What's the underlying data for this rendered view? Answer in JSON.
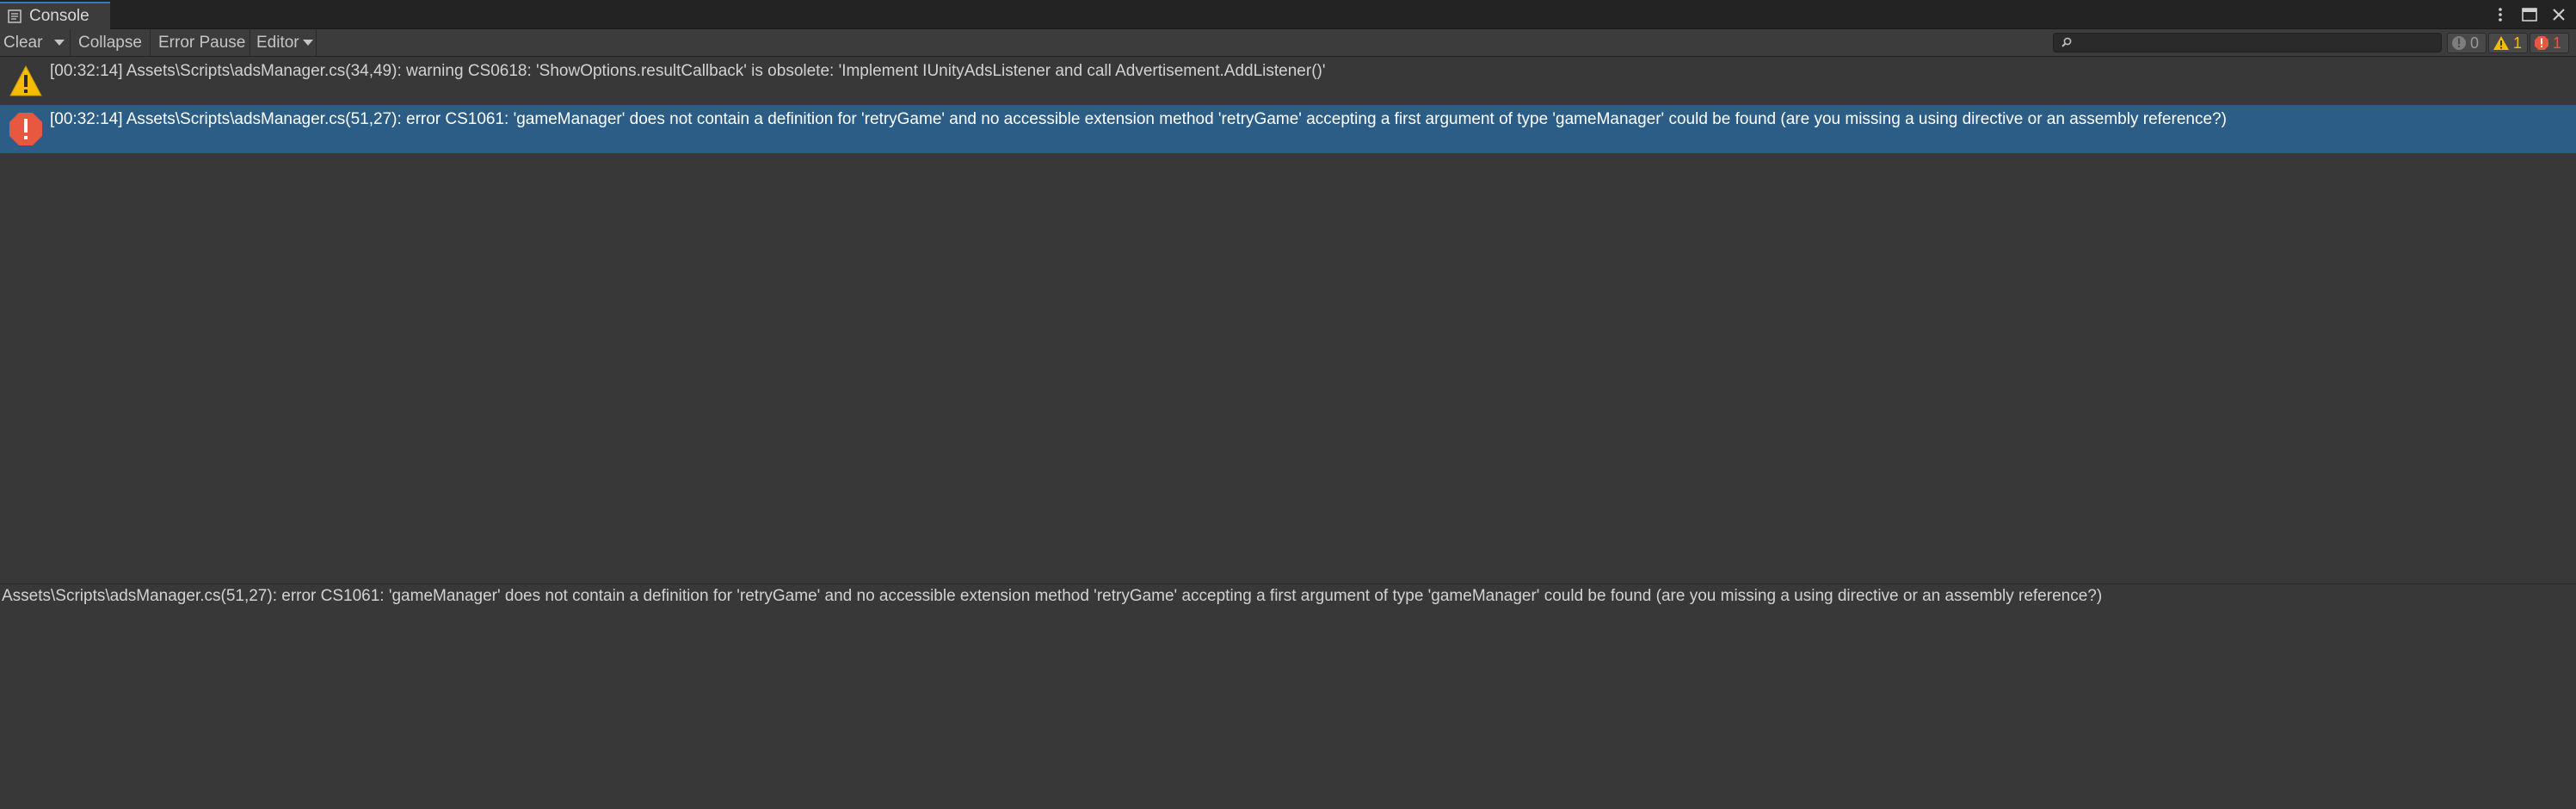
{
  "window": {
    "tab_title": "Console",
    "icons": [
      "console-icon",
      "kebab-menu-icon",
      "maximize-icon",
      "close-icon"
    ]
  },
  "toolbar": {
    "clear_label": "Clear",
    "collapse_label": "Collapse",
    "error_pause_label": "Error Pause",
    "editor_label": "Editor",
    "search": {
      "value": "",
      "placeholder": ""
    },
    "counters": {
      "info": "0",
      "warning": "1",
      "error": "1"
    }
  },
  "logs": [
    {
      "type": "warning",
      "icon": "warning-icon",
      "text": "[00:32:14] Assets\\Scripts\\adsManager.cs(34,49): warning CS0618: 'ShowOptions.resultCallback' is obsolete: 'Implement IUnityAdsListener and call Advertisement.AddListener()'",
      "selected": false
    },
    {
      "type": "error",
      "icon": "error-icon",
      "text": "[00:32:14] Assets\\Scripts\\adsManager.cs(51,27): error CS1061: 'gameManager' does not contain a definition for 'retryGame' and no accessible extension method 'retryGame' accepting a first argument of type 'gameManager' could be found (are you missing a using directive or an assembly reference?)",
      "selected": true
    }
  ],
  "detail": {
    "text": "Assets\\Scripts\\adsManager.cs(51,27): error CS1061: 'gameManager' does not contain a definition for 'retryGame' and no accessible extension method 'retryGame' accepting a first argument of type 'gameManager' could be found (are you missing a using directive or an assembly reference?)"
  },
  "colors": {
    "background": "#383838",
    "selected_row": "#2c5d87",
    "warning": "#f4bc02",
    "error": "#e8573f",
    "tab_accent": "#3a79bb"
  }
}
